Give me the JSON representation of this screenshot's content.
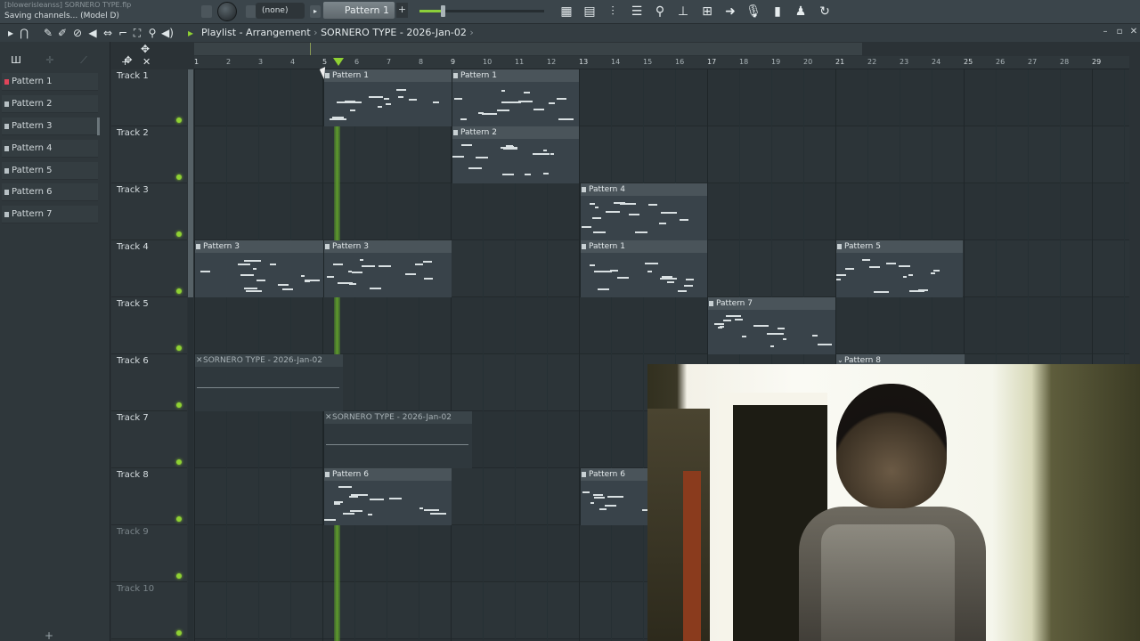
{
  "top": {
    "project_title": "[blowerisleanss] SORNERO TYPE.flp",
    "status": "Saving channels... (Model D)",
    "none_label": "(none)",
    "pattern_label": "Pattern 1",
    "add_label": "+"
  },
  "titlebar": {
    "title": "Playlist - Arrangement",
    "separator": "›",
    "arrangement": "SORNERO TYPE - 2026-Jan-02",
    "after": "›"
  },
  "picker": {
    "items": [
      "Pattern 1",
      "Pattern 2",
      "Pattern 3",
      "Pattern 4",
      "Pattern 5",
      "Pattern 6",
      "Pattern 7"
    ],
    "add": "+"
  },
  "tracks": [
    "Track 1",
    "Track 2",
    "Track 3",
    "Track 4",
    "Track 5",
    "Track 6",
    "Track 7",
    "Track 8",
    "Track 9",
    "Track 10"
  ],
  "ruler": [
    "1",
    "2",
    "3",
    "4",
    "5",
    "6",
    "7",
    "8",
    "9",
    "10",
    "11",
    "12",
    "13",
    "14",
    "15",
    "16",
    "17",
    "18",
    "19",
    "20",
    "21",
    "22",
    "23",
    "24",
    "25",
    "26",
    "27",
    "28",
    "29"
  ],
  "clips": {
    "t1a": "Pattern 1",
    "t1b": "Pattern 1",
    "t2a": "Pattern 2",
    "t3a": "Pattern 4",
    "t4a": "Pattern 3",
    "t4b": "Pattern 3",
    "t4c": "Pattern 1",
    "t4d": "Pattern 5",
    "t5a": "Pattern 7",
    "t6a": "SORNERO TYPE - 2026-Jan-02",
    "t6b": "Pattern 8",
    "t7a": "SORNERO TYPE - 2026-Jan-02",
    "t8a": "Pattern 6",
    "t8b": "Pattern 6"
  },
  "colors": {
    "accent_green": "#8fd133",
    "active_pattern": "#e0455a"
  }
}
